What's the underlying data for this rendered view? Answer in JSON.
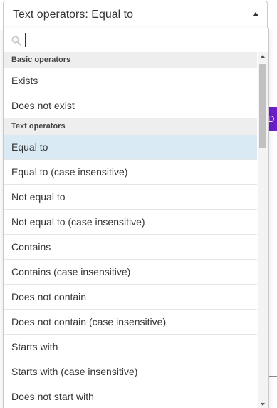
{
  "select": {
    "value": "Text operators: Equal to"
  },
  "search": {
    "placeholder": ""
  },
  "background": {
    "button_fragment": "D"
  },
  "groups": [
    {
      "label": "Basic operators",
      "options": [
        {
          "label": "Exists"
        },
        {
          "label": "Does not exist"
        }
      ]
    },
    {
      "label": "Text operators",
      "options": [
        {
          "label": "Equal to",
          "selected": true
        },
        {
          "label": "Equal to (case insensitive)"
        },
        {
          "label": "Not equal to"
        },
        {
          "label": "Not equal to (case insensitive)"
        },
        {
          "label": "Contains"
        },
        {
          "label": "Contains (case insensitive)"
        },
        {
          "label": "Does not contain"
        },
        {
          "label": "Does not contain (case insensitive)"
        },
        {
          "label": "Starts with"
        },
        {
          "label": "Starts with (case insensitive)"
        },
        {
          "label": "Does not start with"
        }
      ]
    }
  ],
  "colors": {
    "selected_bg": "#d9eaf4",
    "group_header_bg": "#eeeeee",
    "accent_button": "#6b1fc6"
  },
  "icons": {
    "search": "search-icon",
    "caret": "caret-up-icon"
  }
}
